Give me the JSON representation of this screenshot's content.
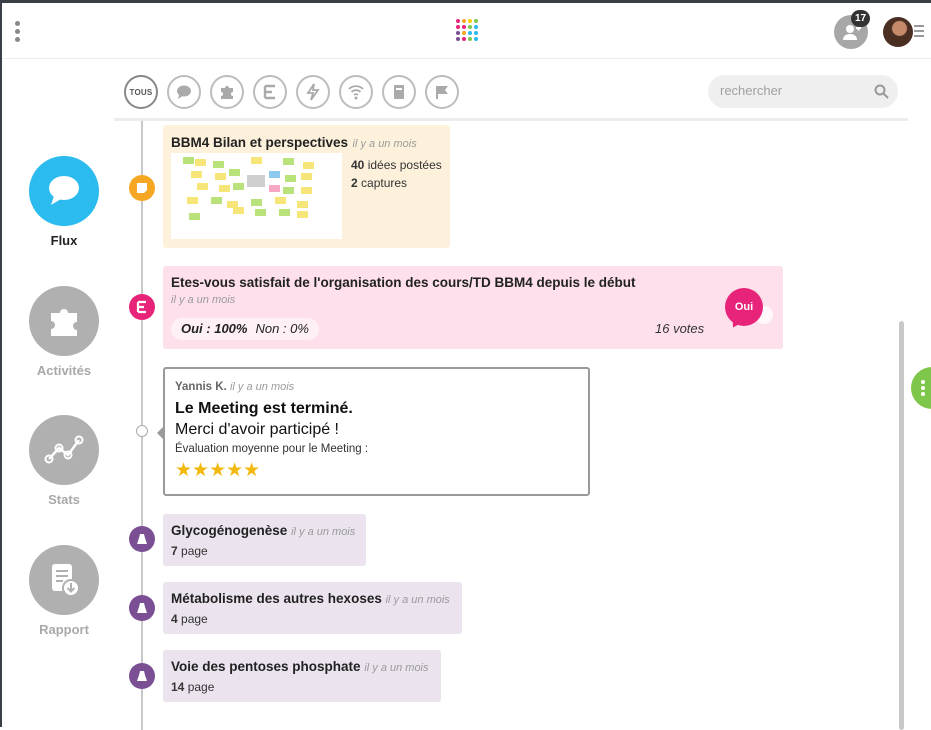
{
  "topbar": {
    "notification_count": "17"
  },
  "filters": {
    "all_label": "TOUS",
    "icons": [
      "chat-icon",
      "puzzle-icon",
      "list-icon",
      "lightning-icon",
      "wifi-icon",
      "book-icon",
      "flag-icon"
    ]
  },
  "search": {
    "placeholder": "rechercher"
  },
  "nav": [
    {
      "label": "Flux",
      "icon": "chat-bubble-icon",
      "active": true
    },
    {
      "label": "Activités",
      "icon": "puzzle-icon",
      "active": false
    },
    {
      "label": "Stats",
      "icon": "graph-icon",
      "active": false
    },
    {
      "label": "Rapport",
      "icon": "report-download-icon",
      "active": false
    }
  ],
  "feed": {
    "brainstorm": {
      "title": "BBM4 Bilan et perspectives",
      "time": "il y a un mois",
      "ideas_count": "40",
      "ideas_label": "idées postées",
      "captures_count": "2",
      "captures_label": "captures"
    },
    "poll": {
      "title": "Etes-vous satisfait de l'organisation des cours/TD BBM4 depuis le début",
      "time": "il y a un mois",
      "yes_result": "Oui : 100%",
      "no_result": "Non : 0%",
      "votes": "16 votes",
      "answer": "Oui",
      "accent": "#e8247a"
    },
    "meeting": {
      "author": "Yannis K.",
      "time": "il y a un mois",
      "headline": "Le Meeting est terminé.",
      "thanks": "Merci d'avoir participé !",
      "rating_label": "Évaluation moyenne pour le Meeting :",
      "rating_stars": 5,
      "stars": "★★★★★"
    },
    "documents": [
      {
        "title": "Glycogénogenèse",
        "time": "il y a un mois",
        "pages": "7",
        "pages_label": "page"
      },
      {
        "title": "Métabolisme des autres hexoses",
        "time": "il y a un mois",
        "pages": "4",
        "pages_label": "page"
      },
      {
        "title": "Voie des pentoses phosphate",
        "time": "il y a un mois",
        "pages": "14",
        "pages_label": "page"
      }
    ]
  },
  "colors": {
    "accent_blue": "#2bbbee",
    "brainstorm_dot": "#f5a623",
    "poll_dot": "#e8247a",
    "document_dot": "#7b4f94",
    "side_tab": "#7fc74a",
    "star": "#f2b80e"
  }
}
